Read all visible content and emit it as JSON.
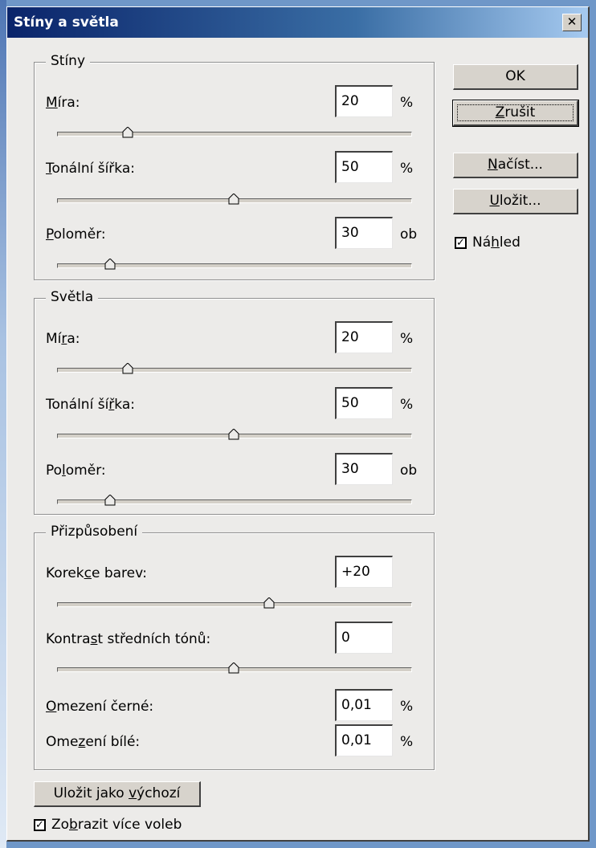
{
  "window": {
    "title": "Stíny a světla",
    "close_glyph": "✕"
  },
  "shadows": {
    "legend": "Stíny",
    "amount": {
      "label_pre": "",
      "label_acc": "M",
      "label_post": "íra:",
      "value": "20",
      "unit": "%",
      "level": 20
    },
    "tonal_width": {
      "label_pre": "",
      "label_acc": "T",
      "label_post": "onální šířka:",
      "value": "50",
      "unit": "%",
      "level": 50
    },
    "radius": {
      "label_pre": "",
      "label_acc": "P",
      "label_post": "oloměr:",
      "value": "30",
      "unit": "ob",
      "level": 15
    }
  },
  "highlights": {
    "legend": "Světla",
    "amount": {
      "label_pre": "Mí",
      "label_acc": "r",
      "label_post": "a:",
      "value": "20",
      "unit": "%",
      "level": 20
    },
    "tonal_width": {
      "label_pre": "Tonální ší",
      "label_acc": "ř",
      "label_post": "ka:",
      "value": "50",
      "unit": "%",
      "level": 50
    },
    "radius": {
      "label_pre": "Po",
      "label_acc": "l",
      "label_post": "oměr:",
      "value": "30",
      "unit": "ob",
      "level": 15
    }
  },
  "adjustments": {
    "legend": "Přizpůsobení",
    "color_correction": {
      "label_pre": "Korek",
      "label_acc": "c",
      "label_post": "e barev:",
      "value": "+20",
      "level": 60
    },
    "midtone_contrast": {
      "label_pre": "Kontra",
      "label_acc": "s",
      "label_post": "t středních tónů:",
      "value": "0",
      "level": 50
    },
    "black_clip": {
      "label_pre": "",
      "label_acc": "O",
      "label_post": "mezení černé:",
      "value": "0,01",
      "unit": "%"
    },
    "white_clip": {
      "label_pre": "Ome",
      "label_acc": "z",
      "label_post": "ení bílé:",
      "value": "0,01",
      "unit": "%"
    }
  },
  "buttons": {
    "ok": "OK",
    "cancel_acc": "Z",
    "cancel_post": "rušit",
    "load_acc": "N",
    "load_post": "ačíst...",
    "save_acc": "U",
    "save_post": "ložit...",
    "save_default_pre": "Uložit jako ",
    "save_default_acc": "v",
    "save_default_post": "ýchozí"
  },
  "preview": {
    "label_pre": "Ná",
    "label_acc": "h",
    "label_post": "led",
    "checked": true
  },
  "more_options": {
    "label_pre": "Zo",
    "label_acc": "b",
    "label_post": "razit více voleb",
    "checked": true
  },
  "colors": {
    "title_start": "#0a246a",
    "title_end": "#a6caf0",
    "dialog_bg": "#ecebe9"
  }
}
